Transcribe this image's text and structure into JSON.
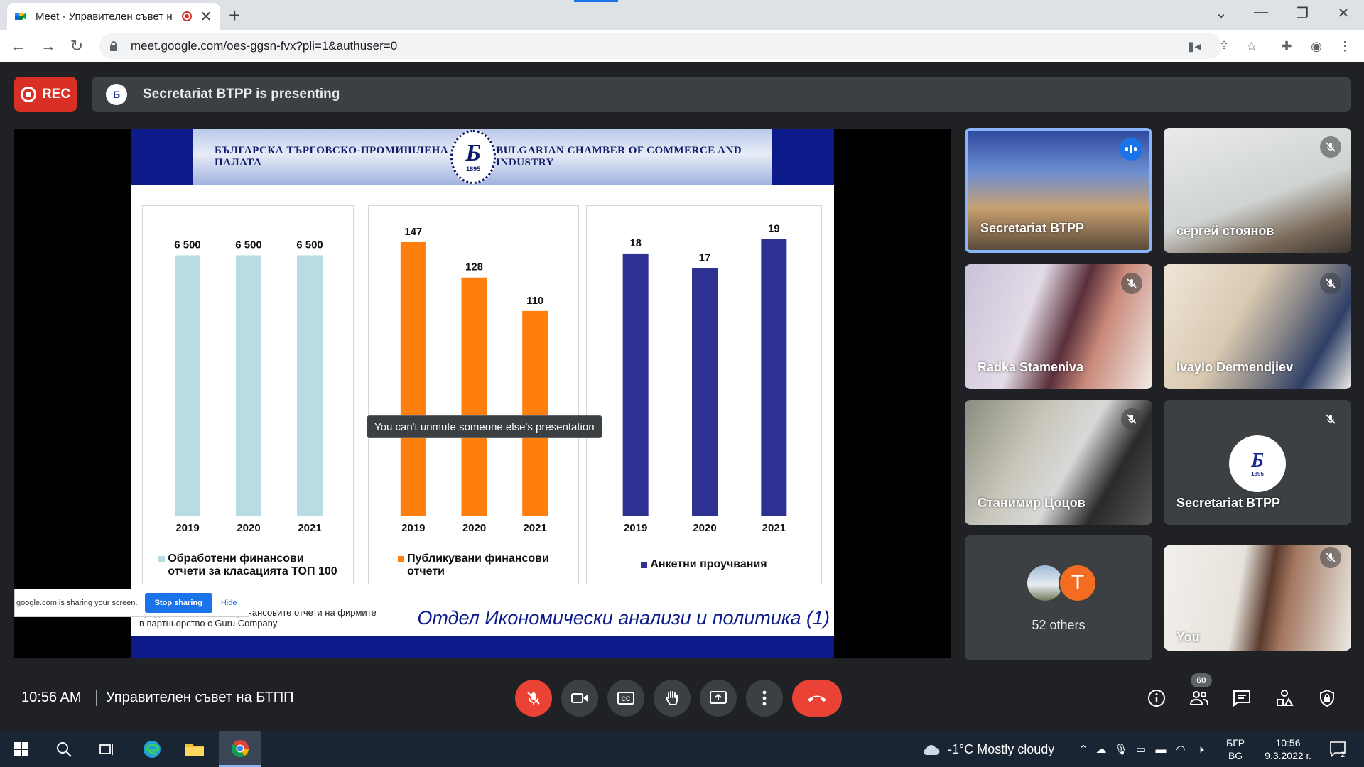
{
  "browser": {
    "tab_title": "Meet - Управителен съвет н",
    "url": "meet.google.com/oes-ggsn-fvx?pli=1&authuser=0"
  },
  "meet": {
    "rec_label": "REC",
    "presenting_text": "Secretariat BTPP is presenting",
    "tooltip": "You can't unmute someone else's presentation",
    "share_bar": {
      "message": "google.com is sharing your screen.",
      "stop_label": "Stop sharing",
      "hide_label": "Hide"
    },
    "slide": {
      "header_left": "БЪЛГАРСКА ТЪРГОВСКО-ПРОМИШЛЕНА ПАЛАТА",
      "header_right": "BULGARIAN CHAMBER OF COMMERCE AND INDUSTRY",
      "seal_year": "1895",
      "caption_line1": "предоставени 80% от финансовите отчети на фирмите",
      "caption_line2": "в партньорство с Guru Company",
      "department": "Отдел Икономически анализи и политика (1)"
    },
    "participants": [
      {
        "name": "Secretariat BTPP",
        "state": "speaking"
      },
      {
        "name": "сергей стоянов",
        "state": "muted"
      },
      {
        "name": "Radka Stameniva",
        "state": "muted"
      },
      {
        "name": "Ivaylo Dermendjiev",
        "state": "muted"
      },
      {
        "name": "Станимир Цоцов",
        "state": "muted"
      },
      {
        "name": "Secretariat BTPP",
        "state": "muted"
      },
      {
        "name": "You",
        "state": "muted"
      }
    ],
    "others_label": "52 others",
    "others_initial": "T",
    "time": "10:56 AM",
    "meeting_name": "Управителен съвет на БТПП",
    "people_count": "60"
  },
  "chart_data": [
    {
      "type": "bar",
      "categories": [
        "2019",
        "2020",
        "2021"
      ],
      "values": [
        6500,
        6500,
        6500
      ],
      "value_labels": [
        "6 500",
        "6 500",
        "6 500"
      ],
      "color": "#b7dde3",
      "legend": "Обработени финансови отчети за класацията ТОП 100",
      "legend_lines": [
        "Обработени финансови",
        "отчети за класацията ТОП 100"
      ],
      "ylim": [
        0,
        7200
      ]
    },
    {
      "type": "bar",
      "categories": [
        "2019",
        "2020",
        "2021"
      ],
      "values": [
        147,
        128,
        110
      ],
      "value_labels": [
        "147",
        "128",
        "110"
      ],
      "color": "#ff7f0e",
      "legend": "Публикувани финансови отчети",
      "legend_lines": [
        "Публикувани финансови",
        "отчети"
      ],
      "ylim": [
        0,
        155
      ]
    },
    {
      "type": "bar",
      "categories": [
        "2019",
        "2020",
        "2021"
      ],
      "values": [
        18,
        17,
        19
      ],
      "value_labels": [
        "18",
        "17",
        "19"
      ],
      "color": "#2e3192",
      "legend": "Анкетни проучвания",
      "legend_lines": [
        "Анкетни проучвания"
      ],
      "ylim": [
        0,
        19.8
      ]
    }
  ],
  "taskbar": {
    "weather": "-1°C  Mostly cloudy",
    "lang_top": "БГР",
    "lang_bottom": "BG",
    "clock_time": "10:56",
    "clock_date": "9.3.2022 г.",
    "notif_count": "2"
  }
}
